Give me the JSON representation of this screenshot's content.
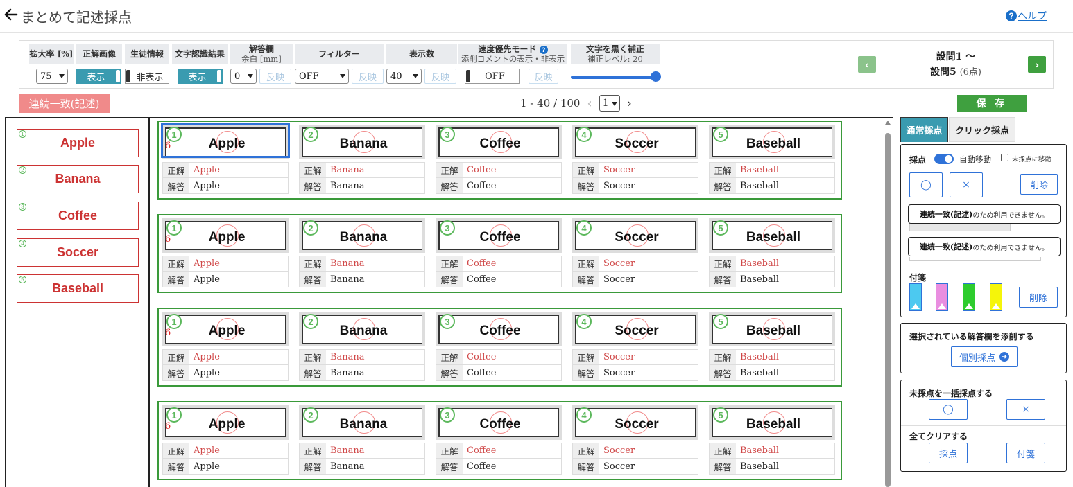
{
  "header": {
    "title": "まとめて記述採点",
    "help_label": "ヘルプ"
  },
  "toolbar": {
    "zoom": {
      "label": "拡大率 [%]",
      "value": "75"
    },
    "correct_image": {
      "label": "正解画像",
      "show": "表示"
    },
    "student_info": {
      "label": "生徒情報",
      "hide": "非表示"
    },
    "ocr_result": {
      "label": "文字認識結果",
      "show": "表示"
    },
    "margin": {
      "label": "解答欄",
      "sub": "余白 [mm]",
      "value": "0",
      "apply": "反映"
    },
    "filter": {
      "label": "フィルター",
      "value": "OFF",
      "apply": "反映"
    },
    "count": {
      "label": "表示数",
      "value": "40",
      "apply": "反映"
    },
    "speed_mode": {
      "label": "速度優先モード",
      "sub": "添削コメントの表示・非表示",
      "value": "OFF",
      "apply": "反映"
    },
    "darken": {
      "label": "文字を黒く補正",
      "sub": "補正レベル: 20",
      "level": 20
    },
    "question_range_top": "設問1 〜",
    "question_range_bottom": "設問5",
    "question_points": "(6点)"
  },
  "consecutive_badge": "連続一致(記述)",
  "pager": {
    "range": "1 - 40 / 100",
    "page": "1"
  },
  "save_label": "保 存",
  "left_panel": {
    "items": [
      {
        "num": "1",
        "text": "Apple"
      },
      {
        "num": "2",
        "text": "Banana"
      },
      {
        "num": "3",
        "text": "Coffee"
      },
      {
        "num": "4",
        "text": "Soccer"
      },
      {
        "num": "5",
        "text": "Baseball"
      }
    ]
  },
  "grid": {
    "correct_label": "正解",
    "answer_label": "解答",
    "score_mark": "6",
    "rows": [
      [
        {
          "num": "1",
          "image_text": "Apple",
          "correct": "Apple",
          "answer": "Apple"
        },
        {
          "num": "2",
          "image_text": "Banana",
          "correct": "Banana",
          "answer": "Banana"
        },
        {
          "num": "3",
          "image_text": "Coffee",
          "correct": "Coffee",
          "answer": "Coffee"
        },
        {
          "num": "4",
          "image_text": "Soccer",
          "correct": "Soccer",
          "answer": "Soccer"
        },
        {
          "num": "5",
          "image_text": "Baseball",
          "correct": "Baseball",
          "answer": "Baseball"
        }
      ],
      [
        {
          "num": "1",
          "image_text": "Apple",
          "correct": "Apple",
          "answer": "Apple"
        },
        {
          "num": "2",
          "image_text": "Banana",
          "correct": "Banana",
          "answer": "Banana"
        },
        {
          "num": "3",
          "image_text": "Coffee",
          "correct": "Coffee",
          "answer": "Coffee"
        },
        {
          "num": "4",
          "image_text": "Soccer",
          "correct": "Soccer",
          "answer": "Soccer"
        },
        {
          "num": "5",
          "image_text": "Baseball",
          "correct": "Baseball",
          "answer": "Baseball"
        }
      ],
      [
        {
          "num": "1",
          "image_text": "Apple",
          "correct": "Apple",
          "answer": "Apple"
        },
        {
          "num": "2",
          "image_text": "Banana",
          "correct": "Banana",
          "answer": "Banana"
        },
        {
          "num": "3",
          "image_text": "Coffee",
          "correct": "Coffee",
          "answer": "Coffee"
        },
        {
          "num": "4",
          "image_text": "Soccer",
          "correct": "Soccer",
          "answer": "Soccer"
        },
        {
          "num": "5",
          "image_text": "Baseball",
          "correct": "Baseball",
          "answer": "Baseball"
        }
      ],
      [
        {
          "num": "1",
          "image_text": "Apple",
          "correct": "Apple",
          "answer": "Apple"
        },
        {
          "num": "2",
          "image_text": "Banana",
          "correct": "Banana",
          "answer": "Banana"
        },
        {
          "num": "3",
          "image_text": "Coffee",
          "correct": "Coffee",
          "answer": "Coffee"
        },
        {
          "num": "4",
          "image_text": "Soccer",
          "correct": "Soccer",
          "answer": "Soccer"
        },
        {
          "num": "5",
          "image_text": "Baseball",
          "correct": "Baseball",
          "answer": "Baseball"
        }
      ]
    ]
  },
  "right_panel": {
    "tab_normal": "通常採点",
    "tab_click": "クリック採点",
    "scoring_label": "採点",
    "auto_move": "自動移動",
    "move_unscored": "未採点に移動",
    "circle": "◯",
    "cross": "×",
    "delete": "削除",
    "notice_strong": "連続一致(記述)",
    "notice_rest": "のため利用できません。",
    "sticky_label": "付箋",
    "sticky_colors": [
      "#4cc9f0",
      "#e98ee0",
      "#2ecc2e",
      "#f5f50a"
    ],
    "annotate_title": "選択されている解答欄を添削する",
    "individual_button": "個別採点",
    "bulk_title": "未採点を一括採点する",
    "clear_title": "全てクリアする",
    "clear_score": "採点",
    "clear_sticky": "付箋"
  },
  "colors": {
    "accent": "#2f72d8",
    "green": "#3a9a3a",
    "teal": "#3a9bb0",
    "badge": "#f08a8a",
    "red_text": "#d04848"
  }
}
